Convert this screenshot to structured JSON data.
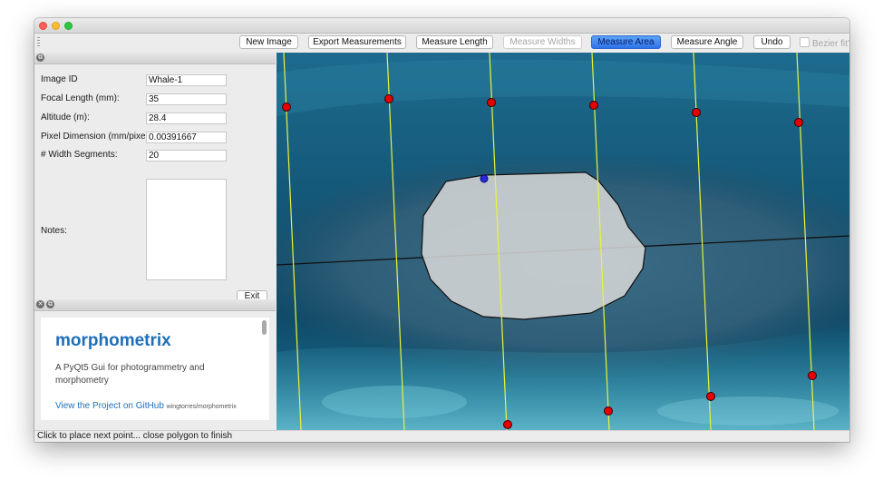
{
  "window": {
    "status": "Click to place next point... close polygon to finish"
  },
  "toolbar": {
    "new_image": "New Image",
    "export": "Export Measurements",
    "measure_length": "Measure Length",
    "measure_widths": "Measure Widths",
    "measure_area": "Measure Area",
    "measure_angle": "Measure Angle",
    "undo": "Undo",
    "bezier_fit": "Bezier fit?"
  },
  "form": {
    "image_id_label": "Image ID",
    "image_id_value": "Whale-1",
    "focal_label": "Focal Length (mm):",
    "focal_value": "35",
    "altitude_label": "Altitude (m):",
    "altitude_value": "28.4",
    "pixel_label": "Pixel Dimension (mm/pixel)",
    "pixel_value": "0.00391667",
    "segments_label": "# Width Segments:",
    "segments_value": "20",
    "notes_label": "Notes:",
    "notes_value": "",
    "exit_label": "Exit"
  },
  "about": {
    "title": "morphometrix",
    "description": "A PyQt5 Gui for photogrammetry and morphometry",
    "link_text": "View the Project on GitHub",
    "link_sub": "wingtorres/morphometrix"
  },
  "icons": {
    "dock_float": "float-icon",
    "dock_close": "close-icon"
  },
  "colors": {
    "active_button": "#2d73e8",
    "width_lines": "#e8f53a",
    "width_points": "#e30000",
    "polygon_fill": "#d9d9d9",
    "link": "#1e6fb8"
  }
}
